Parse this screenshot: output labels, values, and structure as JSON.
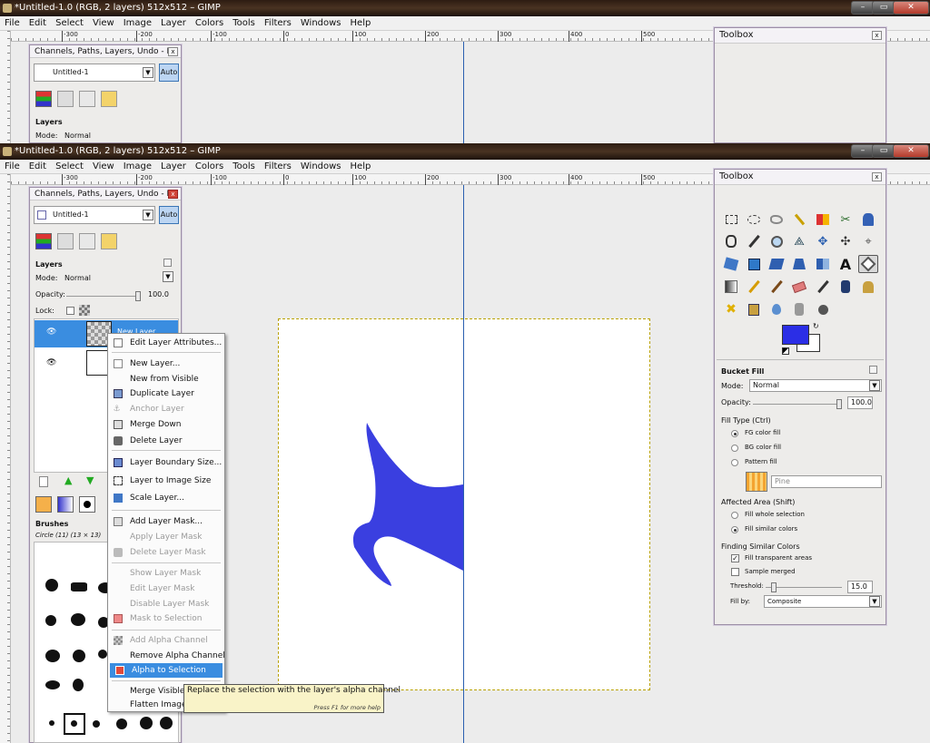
{
  "window_back": {
    "title": "*Untitled-1.0 (RGB, 2 layers) 512x512 – GIMP",
    "controls": [
      "–",
      "▭",
      "✕"
    ]
  },
  "window_front": {
    "title": "*Untitled-1.0 (RGB, 2 layers) 512x512 – GIMP",
    "controls": [
      "–",
      "▭",
      "✕"
    ]
  },
  "menubar": [
    "File",
    "Edit",
    "Select",
    "View",
    "Image",
    "Layer",
    "Colors",
    "Tools",
    "Filters",
    "Windows",
    "Help"
  ],
  "ruler_labels": [
    "-300",
    "-200",
    "-100",
    "0",
    "100",
    "200",
    "300",
    "400",
    "500"
  ],
  "layers_dock": {
    "title": "Channels, Paths, Layers, Undo - P...",
    "image_select": "Untitled-1",
    "auto_label": "Auto",
    "section_title": "Layers",
    "mode_label": "Mode:",
    "mode_value": "Normal",
    "opacity_label": "Opacity:",
    "opacity_value": "100.0",
    "lock_label": "Lock:",
    "layer1_name": "New Layer"
  },
  "brushes": {
    "title": "Brushes",
    "current": "Circle (11) (13 × 13)"
  },
  "toolbox": {
    "title": "Toolbox",
    "tool_options_title": "Bucket Fill",
    "mode_label": "Mode:",
    "mode_value": "Normal",
    "opacity_label": "Opacity:",
    "opacity_value": "100.0",
    "fill_type_label": "Fill Type  (Ctrl)",
    "fill_fg": "FG color fill",
    "fill_bg": "BG color fill",
    "fill_pattern": "Pattern fill",
    "pattern_name": "Pine",
    "affected_label": "Affected Area  (Shift)",
    "aff_whole": "Fill whole selection",
    "aff_similar": "Fill similar colors",
    "finding_label": "Finding Similar Colors",
    "fill_transparent": "Fill transparent areas",
    "sample_merged": "Sample merged",
    "threshold_label": "Threshold:",
    "threshold_value": "15.0",
    "fillby_label": "Fill by:",
    "fillby_value": "Composite",
    "fg_color": "#2b2ee6",
    "bg_color": "#ffffff"
  },
  "context_menu": {
    "items": [
      {
        "label": "Edit Layer Attributes...",
        "enabled": true
      },
      {
        "label": "New Layer...",
        "enabled": true
      },
      {
        "label": "New from Visible",
        "enabled": true
      },
      {
        "label": "Duplicate Layer",
        "enabled": true
      },
      {
        "label": "Anchor Layer",
        "enabled": false
      },
      {
        "label": "Merge Down",
        "enabled": true
      },
      {
        "label": "Delete Layer",
        "enabled": true
      },
      {
        "label": "Layer Boundary Size...",
        "enabled": true
      },
      {
        "label": "Layer to Image Size",
        "enabled": true
      },
      {
        "label": "Scale Layer...",
        "enabled": true
      },
      {
        "label": "Add Layer Mask...",
        "enabled": true
      },
      {
        "label": "Apply Layer Mask",
        "enabled": false
      },
      {
        "label": "Delete Layer Mask",
        "enabled": false
      },
      {
        "label": "Show Layer Mask",
        "enabled": false
      },
      {
        "label": "Edit Layer Mask",
        "enabled": false
      },
      {
        "label": "Disable Layer Mask",
        "enabled": false
      },
      {
        "label": "Mask to Selection",
        "enabled": false
      },
      {
        "label": "Add Alpha Channel",
        "enabled": false
      },
      {
        "label": "Remove Alpha Channel",
        "enabled": true
      },
      {
        "label": "Alpha to Selection",
        "enabled": true,
        "highlighted": true
      },
      {
        "label": "Merge Visible Layers...",
        "enabled": true
      },
      {
        "label": "Flatten Image",
        "enabled": true
      }
    ]
  },
  "tooltip": {
    "text": "Replace the selection with the layer's alpha channel",
    "hint": "Press F1 for more help"
  },
  "colors": {
    "shape_fill": "#3a3fe0",
    "highlight": "#3a8de0",
    "selection_dash": "#b8a000"
  }
}
